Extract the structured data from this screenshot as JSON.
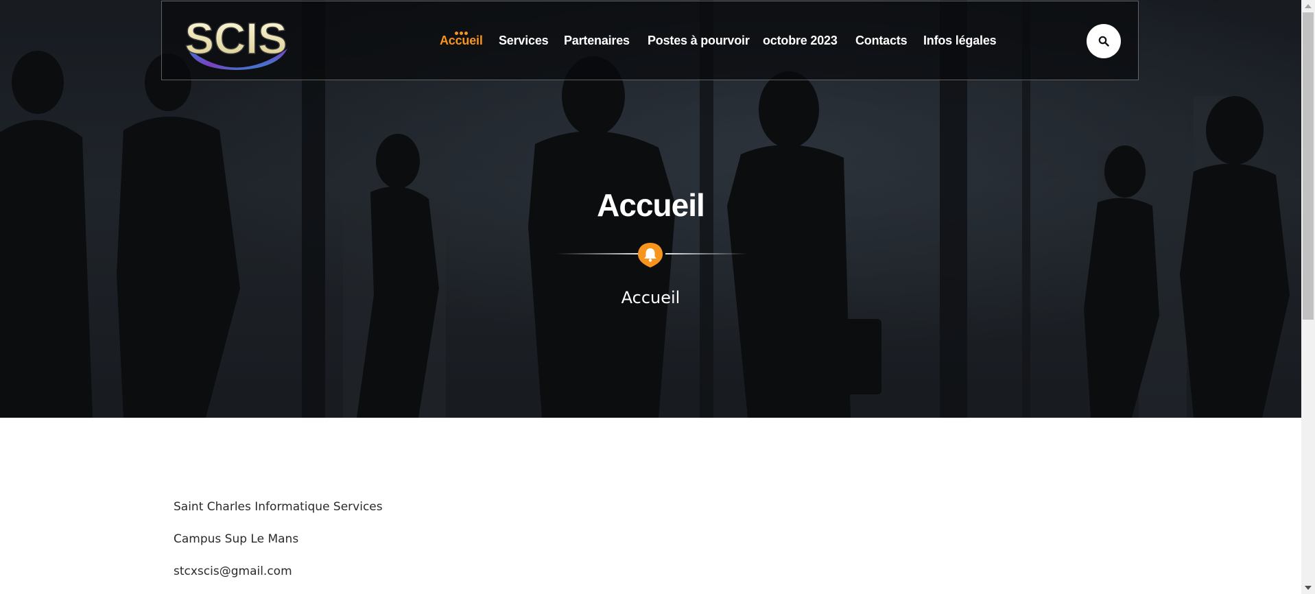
{
  "header": {
    "logo_text": "SCIS",
    "nav": [
      {
        "label": "Accueil",
        "active": true
      },
      {
        "label": "Services",
        "active": false
      },
      {
        "label": "Partenaires",
        "active": false
      },
      {
        "label": "Postes à pourvoir",
        "active": false
      },
      {
        "label": "octobre 2023",
        "active": false
      },
      {
        "label": "Contacts",
        "active": false
      },
      {
        "label": "Infos légales",
        "active": false
      }
    ],
    "search_icon": "search-icon"
  },
  "hero": {
    "title": "Accueil",
    "subtitle": "Accueil",
    "badge_icon": "bell-icon"
  },
  "content": {
    "lines": [
      "Saint Charles Informatique Services",
      "Campus Sup Le Mans",
      "stcxscis@gmail.com"
    ]
  },
  "colors": {
    "accent": "#f7941d",
    "header_bg": "#0a0c0e",
    "text_dark": "#2a2a2a"
  }
}
